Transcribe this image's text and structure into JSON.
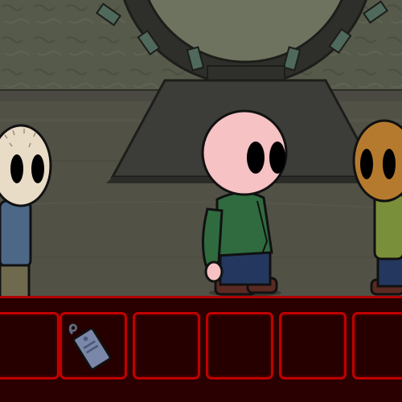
{
  "scene": {
    "location": "gate-room",
    "colors": {
      "wall": "#565a4a",
      "floor": "#515146",
      "gate_ring": "#2e2f2b",
      "gate_inner": "#6e735f",
      "chevron": "#4f6a5c",
      "pedestal": "#3c3d38"
    }
  },
  "characters": [
    {
      "id": "left-character",
      "head_color": "#e8dcc7",
      "shirt_color": "#4d6787",
      "pants_color": "#6f6a4e"
    },
    {
      "id": "player-character",
      "head_color": "#f6c2c4",
      "shirt_color": "#2f6b3f",
      "pants_color": "#24375f"
    },
    {
      "id": "right-character",
      "head_color": "#b67a2e",
      "shirt_color": "#7a8f3a",
      "pants_color": "#24375f"
    }
  ],
  "inventory": {
    "accent_color": "#c00000",
    "background_color": "#2a0000",
    "slots": [
      {
        "item": "",
        "icon": ""
      },
      {
        "item": "keycard",
        "icon": "keycard-icon"
      },
      {
        "item": "",
        "icon": ""
      },
      {
        "item": "",
        "icon": ""
      },
      {
        "item": "",
        "icon": ""
      },
      {
        "item": "",
        "icon": ""
      }
    ]
  }
}
